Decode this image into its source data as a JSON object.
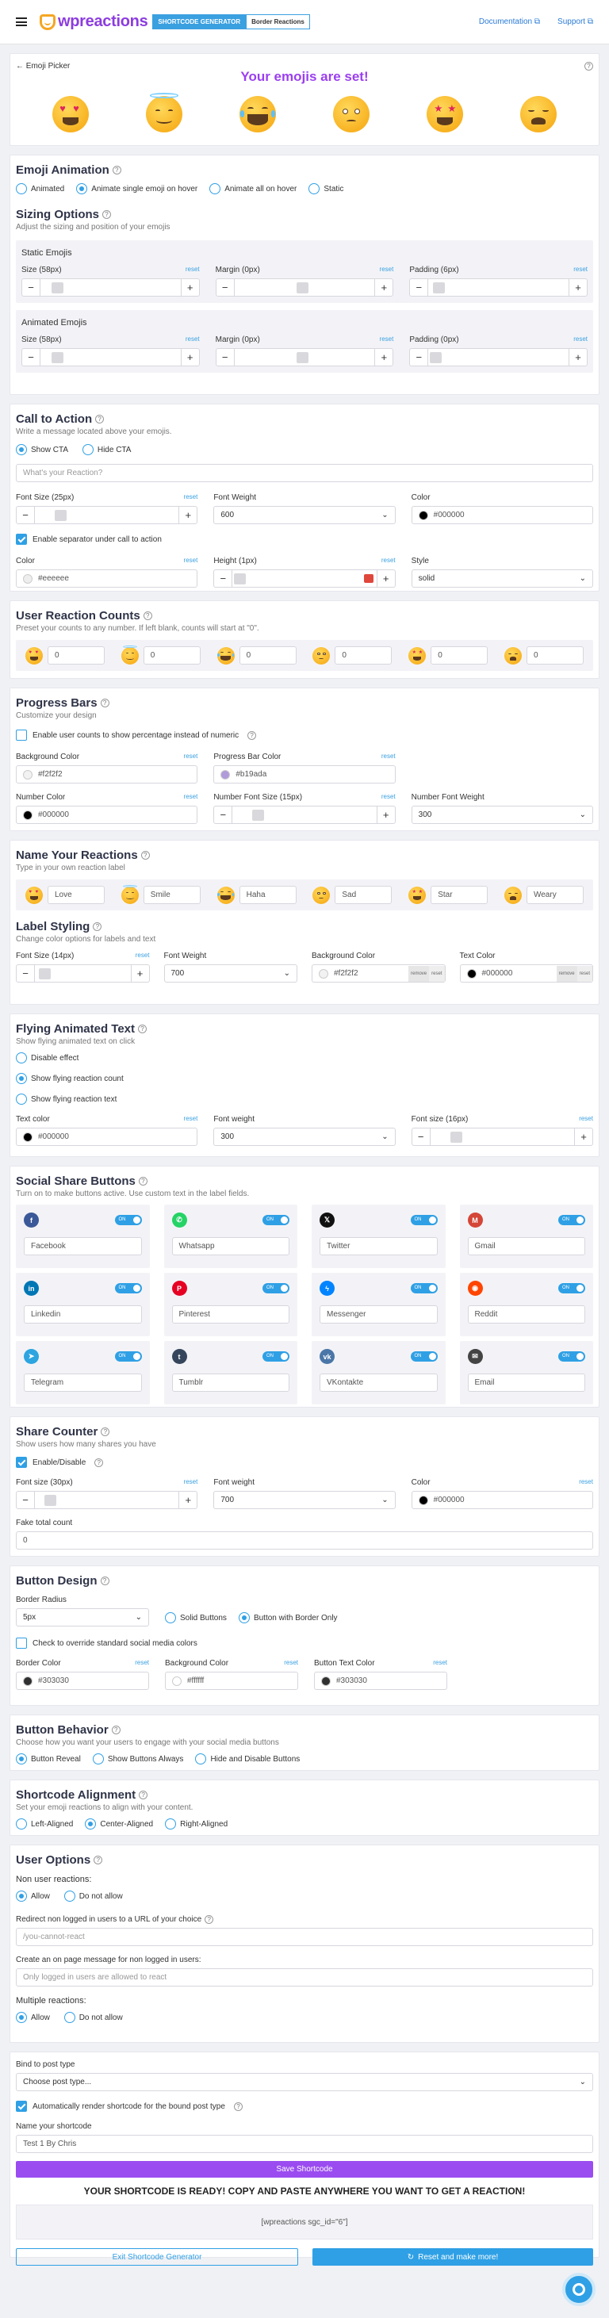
{
  "header": {
    "logo": "wpreactions",
    "badge1": "SHORTCODE GENERATOR",
    "badge2": "Border Reactions",
    "docs": "Documentation",
    "support": "Support"
  },
  "picker": {
    "back": "Emoji Picker",
    "title": "Your emojis are set!"
  },
  "animation": {
    "title": "Emoji Animation",
    "options": [
      "Animated",
      "Animate single emoji on hover",
      "Animate all on hover",
      "Static"
    ],
    "selected": 1
  },
  "sizing": {
    "title": "Sizing Options",
    "subtitle": "Adjust the sizing and position of your emojis",
    "static_title": "Static Emojis",
    "animated_title": "Animated Emojis",
    "static": {
      "size": "Size (58px)",
      "margin": "Margin (0px)",
      "padding": "Padding (6px)"
    },
    "animated": {
      "size": "Size (58px)",
      "margin": "Margin (0px)",
      "padding": "Padding (0px)"
    },
    "reset": "reset"
  },
  "cta": {
    "title": "Call to Action",
    "subtitle": "Write a message located above your emojis.",
    "show": "Show CTA",
    "hide": "Hide CTA",
    "placeholder": "What's your Reaction?",
    "font_size": "Font Size (25px)",
    "font_weight": "Font Weight",
    "weight_val": "600",
    "color": "Color",
    "color_val": "#000000",
    "separator": "Enable separator under call to action",
    "sep_color": "Color",
    "sep_color_val": "#eeeeee",
    "height": "Height (1px)",
    "style": "Style",
    "style_val": "solid",
    "reset": "reset"
  },
  "counts": {
    "title": "User Reaction Counts",
    "subtitle": "Preset your counts to any number. If left blank, counts will start at \"0\".",
    "values": [
      "0",
      "0",
      "0",
      "0",
      "0",
      "0"
    ]
  },
  "progress": {
    "title": "Progress Bars",
    "subtitle": "Customize your design",
    "enable": "Enable user counts to show percentage instead of numeric",
    "bg": "Background Color",
    "bg_val": "#f2f2f2",
    "bar": "Progress Bar Color",
    "bar_val": "#b19ada",
    "num_color": "Number Color",
    "num_color_val": "#000000",
    "num_size": "Number Font Size (15px)",
    "num_weight": "Number Font Weight",
    "num_weight_val": "300",
    "reset": "reset"
  },
  "names": {
    "title": "Name Your Reactions",
    "subtitle": "Type in your own reaction label",
    "labels": [
      "Love",
      "Smile",
      "Haha",
      "Sad",
      "Star",
      "Weary"
    ]
  },
  "label_style": {
    "title": "Label Styling",
    "subtitle": "Change color options for labels and text",
    "font_size": "Font Size (14px)",
    "font_weight": "Font Weight",
    "weight_val": "700",
    "bg": "Background Color",
    "bg_val": "#f2f2f2",
    "text": "Text Color",
    "text_val": "#000000",
    "remove": "remove",
    "reset": "reset"
  },
  "flying": {
    "title": "Flying Animated Text",
    "subtitle": "Show flying animated text on click",
    "options": [
      "Disable effect",
      "Show flying reaction count",
      "Show flying reaction text"
    ],
    "selected": 1,
    "text_color": "Text color",
    "text_color_val": "#000000",
    "weight": "Font weight",
    "weight_val": "300",
    "size": "Font size (16px)",
    "reset": "reset"
  },
  "social": {
    "title": "Social Share Buttons",
    "subtitle": "Turn on to make buttons active. Use custom text in the label fields.",
    "on": "ON",
    "items": [
      {
        "name": "Facebook",
        "icon": "facebook-icon",
        "color": "#3b5998",
        "glyph": "f"
      },
      {
        "name": "Whatsapp",
        "icon": "whatsapp-icon",
        "color": "#25d366",
        "glyph": "✆"
      },
      {
        "name": "Twitter",
        "icon": "twitter-icon",
        "color": "#111111",
        "glyph": "𝕏"
      },
      {
        "name": "Gmail",
        "icon": "gmail-icon",
        "color": "#d44638",
        "glyph": "M"
      },
      {
        "name": "Linkedin",
        "icon": "linkedin-icon",
        "color": "#0077b5",
        "glyph": "in"
      },
      {
        "name": "Pinterest",
        "icon": "pinterest-icon",
        "color": "#e60023",
        "glyph": "P"
      },
      {
        "name": "Messenger",
        "icon": "messenger-icon",
        "color": "#0084ff",
        "glyph": "ϟ"
      },
      {
        "name": "Reddit",
        "icon": "reddit-icon",
        "color": "#ff4500",
        "glyph": "◉"
      },
      {
        "name": "Telegram",
        "icon": "telegram-icon",
        "color": "#2ca5e0",
        "glyph": "➤"
      },
      {
        "name": "Tumblr",
        "icon": "tumblr-icon",
        "color": "#35465c",
        "glyph": "t"
      },
      {
        "name": "VKontakte",
        "icon": "vk-icon",
        "color": "#4a76a8",
        "glyph": "vk"
      },
      {
        "name": "Email",
        "icon": "email-icon",
        "color": "#444444",
        "glyph": "✉"
      }
    ]
  },
  "share_counter": {
    "title": "Share Counter",
    "subtitle": "Show users how many shares you have",
    "enable": "Enable/Disable",
    "font_size": "Font size (30px)",
    "weight": "Font weight",
    "weight_val": "700",
    "color": "Color",
    "color_val": "#000000",
    "fake": "Fake total count",
    "fake_val": "0",
    "reset": "reset"
  },
  "button_design": {
    "title": "Button Design",
    "radius": "Border Radius",
    "radius_val": "5px",
    "solid": "Solid Buttons",
    "border": "Button with Border Only",
    "override": "Check to override standard social media colors",
    "border_color": "Border Color",
    "border_color_val": "#303030",
    "bg_color": "Background Color",
    "bg_color_val": "#ffffff",
    "text_color": "Button Text Color",
    "text_color_val": "#303030",
    "reset": "reset"
  },
  "behavior": {
    "title": "Button Behavior",
    "subtitle": "Choose how you want your users to engage with your social media buttons",
    "options": [
      "Button Reveal",
      "Show Buttons Always",
      "Hide and Disable Buttons"
    ],
    "selected": 0
  },
  "alignment": {
    "title": "Shortcode Alignment",
    "subtitle": "Set your emoji reactions to align with your content.",
    "options": [
      "Left-Aligned",
      "Center-Aligned",
      "Right-Aligned"
    ],
    "selected": 1
  },
  "user_options": {
    "title": "User Options",
    "non_user": "Non user reactions:",
    "allow": "Allow",
    "disallow": "Do not allow",
    "redirect": "Redirect non logged in users to a URL of your choice",
    "redirect_val": "/you-cannot-react",
    "message": "Create an on page message for non logged in users:",
    "message_val": "Only logged in users are allowed to react",
    "multiple": "Multiple reactions:"
  },
  "bind": {
    "label": "Bind to post type",
    "placeholder": "Choose post type...",
    "auto": "Automatically render shortcode for the bound post type",
    "name_label": "Name your shortcode",
    "name_val": "Test 1 By Chris",
    "save": "Save Shortcode",
    "ready": "YOUR SHORTCODE IS READY! COPY AND PASTE ANYWHERE YOU WANT TO GET A REACTION!",
    "shortcode": "[wpreactions sgc_id=\"6\"]",
    "exit": "Exit Shortcode Generator",
    "reset": "Reset and make more!"
  },
  "colors": {
    "accent": "#2fa0e5",
    "purple": "#9a4cf0",
    "title_purple": "#9b3ff0"
  }
}
